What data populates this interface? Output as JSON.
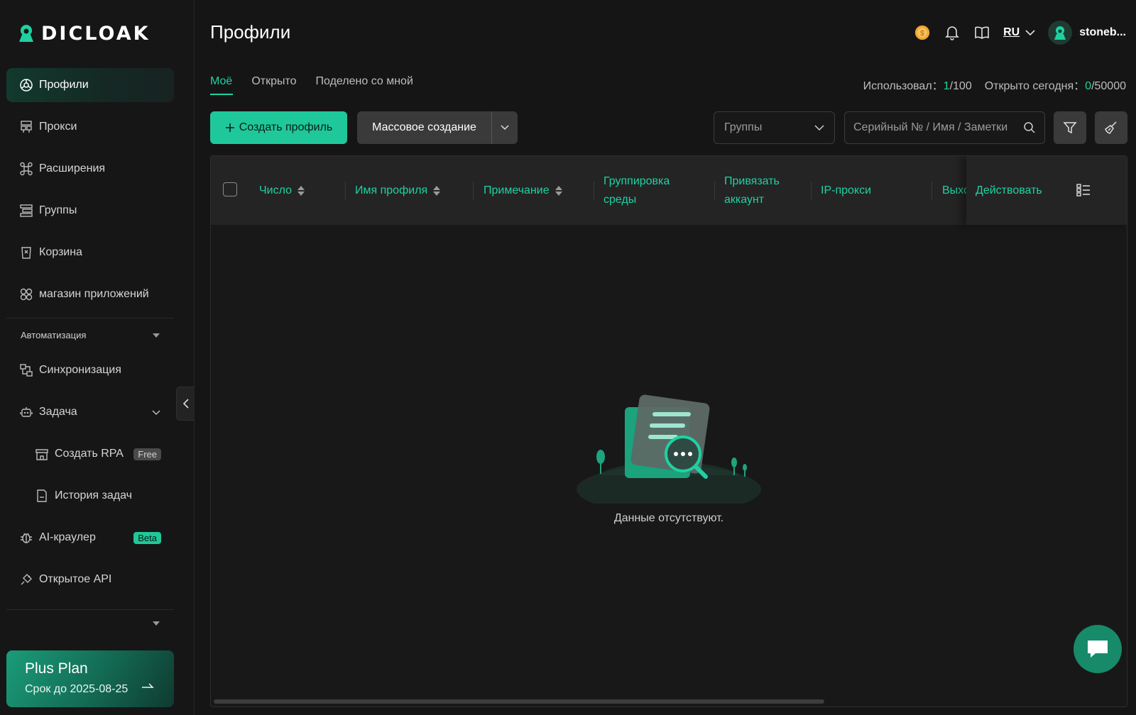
{
  "app": {
    "logo_text": "DICLOAK",
    "page_title": "Профили"
  },
  "sidebar": {
    "items": [
      {
        "label": "Профили",
        "icon": "profiles-icon",
        "active": true
      },
      {
        "label": "Прокси",
        "icon": "proxy-icon"
      },
      {
        "label": "Расширения",
        "icon": "extensions-icon"
      },
      {
        "label": "Группы",
        "icon": "groups-icon"
      },
      {
        "label": "Корзина",
        "icon": "trash-icon"
      },
      {
        "label": "магазин приложений",
        "icon": "app-store-icon"
      }
    ],
    "automation_section": "Автоматизация",
    "automation_items": [
      {
        "label": "Синхронизация",
        "icon": "sync-icon"
      },
      {
        "label": "Задача",
        "icon": "robot-icon"
      },
      {
        "label": "Создать RPA",
        "icon": "rpa-icon",
        "badge": "Free"
      },
      {
        "label": "История задач",
        "icon": "history-icon"
      },
      {
        "label": "AI-краулер",
        "icon": "bug-icon",
        "badge": "Beta"
      },
      {
        "label": "Открытое API",
        "icon": "api-icon"
      }
    ],
    "plan": {
      "title": "Plus Plan",
      "expiry": "Срок до 2025-08-25"
    }
  },
  "header": {
    "language": "RU",
    "username": "stoneb..."
  },
  "tabs": [
    "Моё",
    "Открыто",
    "Поделено со мной"
  ],
  "usage": {
    "used_label": "Использовал：",
    "used_value": "1",
    "used_total": "/100",
    "opened_label": "Открыто сегодня：",
    "opened_value": "0",
    "opened_total": "/50000"
  },
  "toolbar": {
    "create_label": "Создать профиль",
    "bulk_label": "Массовое создание",
    "groups_placeholder": "Группы",
    "search_placeholder": "Серийный № / Имя / Заметки"
  },
  "table": {
    "columns": {
      "number": "Число",
      "name": "Имя профиля",
      "note": "Примечание",
      "group": "Группировка среды",
      "bind": "Привязать аккаунт",
      "proxy": "IP-прокси",
      "exit": "Выхо",
      "action": "Действовать"
    },
    "empty_text": "Данные отсутствуют."
  },
  "colors": {
    "accent": "#1fd1a2",
    "primary_button": "#1fc89a",
    "background": "#151515"
  }
}
